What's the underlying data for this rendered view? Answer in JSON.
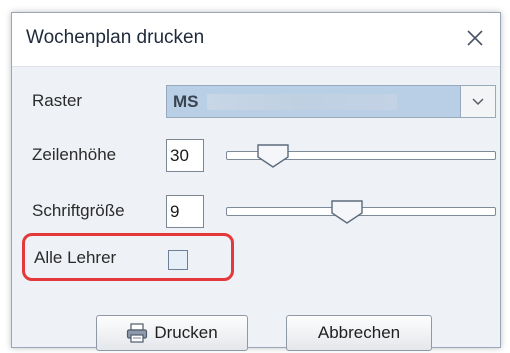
{
  "dialog": {
    "title": "Wochenplan drucken",
    "close_icon": "close-icon"
  },
  "raster": {
    "label": "Raster",
    "value": "MS",
    "dropdown_icon": "chevron-down-icon"
  },
  "zeilenhoehe": {
    "label": "Zeilenhöhe",
    "value": "30"
  },
  "schriftgroesse": {
    "label": "Schriftgröße",
    "value": "9"
  },
  "alle_lehrer": {
    "label": "Alle Lehrer",
    "checked": false
  },
  "buttons": {
    "print_label": "Drucken",
    "print_icon": "printer-icon",
    "cancel_label": "Abbrechen"
  },
  "colors": {
    "highlight": "#e5383b",
    "combo_selected": "#b9cfe6"
  }
}
